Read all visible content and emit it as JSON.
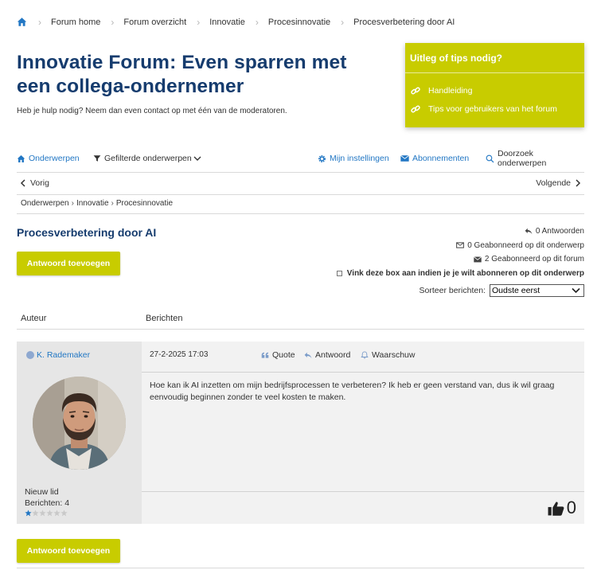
{
  "breadcrumb": {
    "home_icon": "home-icon",
    "items": [
      "Forum home",
      "Forum overzicht",
      "Innovatie",
      "Procesinnovatie",
      "Procesverbetering door AI"
    ]
  },
  "page": {
    "title": "Innovatie Forum: Even sparren met een collega-ondernemer",
    "subtitle": "Heb je hulp nodig? Neem dan even contact op met één van de moderatoren."
  },
  "tips_box": {
    "heading": "Uitleg of tips nodig?",
    "links": [
      "Handleiding",
      "Tips voor gebruikers van het forum"
    ],
    "background": "#c8cc00"
  },
  "toolbar": {
    "topics": "Onderwerpen",
    "filtered": "Gefilterde onderwerpen",
    "settings": "Mijn instellingen",
    "subscriptions": "Abonnementen",
    "search": "Doorzoek onderwerpen"
  },
  "pager": {
    "prev": "Vorig",
    "next": "Volgende"
  },
  "subcrumb": [
    "Onderwerpen",
    "Innovatie",
    "Procesinnovatie"
  ],
  "topic": {
    "title": "Procesverbetering door AI",
    "replies": "0 Antwoorden",
    "subscribed_topic": "0 Geabonneerd op dit onderwerp",
    "subscribed_forum": "2 Geabonneerd op dit forum",
    "subscribe_checkbox": "Vink deze box aan indien je je wilt abonneren op dit onderwerp"
  },
  "buttons": {
    "reply_top": "Antwoord toevoegen",
    "reply_bottom": "Antwoord toevoegen"
  },
  "sort": {
    "label": "Sorteer berichten:",
    "selected": "Oudste eerst"
  },
  "columns": {
    "author": "Auteur",
    "messages": "Berichten"
  },
  "post": {
    "author": "K. Rademaker",
    "rank": "Nieuw lid",
    "post_count": "Berichten: 4",
    "date": "27-2-2025 17:03",
    "quote": "Quote",
    "reply": "Antwoord",
    "warn": "Waarschuw",
    "body": "Hoe kan ik AI inzetten om mijn bedrijfsprocessen te verbeteren? Ik heb er geen verstand van, dus ik wil graag eenvoudig beginnen zonder te veel kosten te maken.",
    "likes": "0",
    "star_rating": 1,
    "star_max": 6
  },
  "colors": {
    "accent": "#c8cc00",
    "link": "#2277c4",
    "heading": "#163c6e"
  }
}
